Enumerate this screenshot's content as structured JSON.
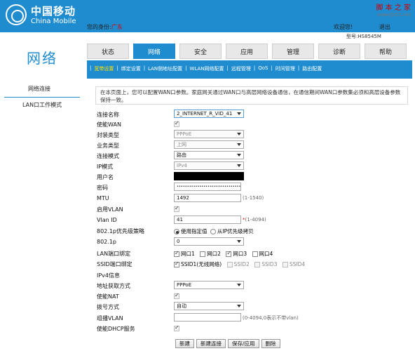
{
  "header": {
    "logo_cn": "中国移动",
    "logo_en": "China Mobile",
    "watermark_top": "脚 本 之 家",
    "watermark_bottom": "www.Jb51.net",
    "identity_label": "您的身份:",
    "identity_value": "广东",
    "welcome": "欢迎您!",
    "logout": "退出",
    "model": "型号:HS8545M"
  },
  "section_title": "网络",
  "tabs": [
    {
      "label": "状态",
      "active": false
    },
    {
      "label": "网络",
      "active": true
    },
    {
      "label": "安全",
      "active": false
    },
    {
      "label": "应用",
      "active": false
    },
    {
      "label": "管理",
      "active": false
    },
    {
      "label": "诊断",
      "active": false
    },
    {
      "label": "帮助",
      "active": false
    }
  ],
  "subtabs": [
    {
      "label": "宽带设置",
      "active": true
    },
    {
      "label": "绑定设置",
      "active": false
    },
    {
      "label": "LAN侧地址配置",
      "active": false
    },
    {
      "label": "WLAN网络配置",
      "active": false
    },
    {
      "label": "远程管理",
      "active": false
    },
    {
      "label": "QoS",
      "active": false
    },
    {
      "label": "时间管理",
      "active": false
    },
    {
      "label": "路由配置",
      "active": false
    }
  ],
  "leftnav": {
    "items": [
      "网络连接",
      "LAN口工作模式"
    ]
  },
  "description": "在本页面上，您可以配置WAN口参数。家庭网关通过WAN口与高层网络设备通信，在通信期间WAN口参数集必须和高层设备参数保持一致。",
  "form": {
    "conn_name": {
      "label": "连接名称",
      "value": "2_INTERNET_R_VID_41"
    },
    "enable_wan": {
      "label": "使能WAN",
      "checked": true
    },
    "encap": {
      "label": "封装类型",
      "value": "PPPoE"
    },
    "service": {
      "label": "业务类型",
      "value": "上网"
    },
    "conn_mode": {
      "label": "连接模式",
      "value": "路由"
    },
    "ip_mode": {
      "label": "IP模式",
      "value": "IPv4"
    },
    "username": {
      "label": "用户名",
      "value": ""
    },
    "password": {
      "label": "密码",
      "value": "••••••••••••••••••••••••••••••••••••••••••••"
    },
    "mtu": {
      "label": "MTU",
      "value": "1492",
      "hint": "(1-1540)"
    },
    "enable_vlan": {
      "label": "启用VLAN",
      "checked": true
    },
    "vlan_id": {
      "label": "Vlan ID",
      "value": "41",
      "star": "*",
      "hint": "(1-4094)"
    },
    "policy_8021p": {
      "label": "802.1p优先级策略",
      "opt1": "使用指定值",
      "opt2": "从IP优先级拷贝"
    },
    "p8021": {
      "label": "802.1p",
      "value": "0"
    },
    "lan_bind": {
      "label": "LAN端口绑定",
      "ports": [
        {
          "label": "网口1",
          "checked": true
        },
        {
          "label": "网口2",
          "checked": false
        },
        {
          "label": "网口3",
          "checked": true
        },
        {
          "label": "网口4",
          "checked": false
        }
      ]
    },
    "ssid_bind": {
      "label": "SSID端口绑定",
      "ports": [
        {
          "label": "SSID1(无线网络)",
          "checked": true,
          "dim": false
        },
        {
          "label": "SSID2",
          "checked": false,
          "dim": true
        },
        {
          "label": "SSID3",
          "checked": false,
          "dim": true
        },
        {
          "label": "SSID4",
          "checked": false,
          "dim": true
        }
      ]
    },
    "ipv4_info": {
      "label": "IPv4信息"
    },
    "addr_mode": {
      "label": "地址获取方式",
      "value": "PPPoE"
    },
    "enable_nat": {
      "label": "使能NAT",
      "checked": true
    },
    "dial_mode": {
      "label": "拨号方式",
      "value": "自动"
    },
    "mcast_vlan": {
      "label": "组播VLAN",
      "value": "",
      "hint": "(0-4094,0表示不带vlan)"
    },
    "enable_dhcp": {
      "label": "使能DHCP服务",
      "checked": true
    }
  },
  "buttons": {
    "new": "新建",
    "new_conn": "新建连接",
    "save": "保存/应用",
    "delete": "删除"
  }
}
